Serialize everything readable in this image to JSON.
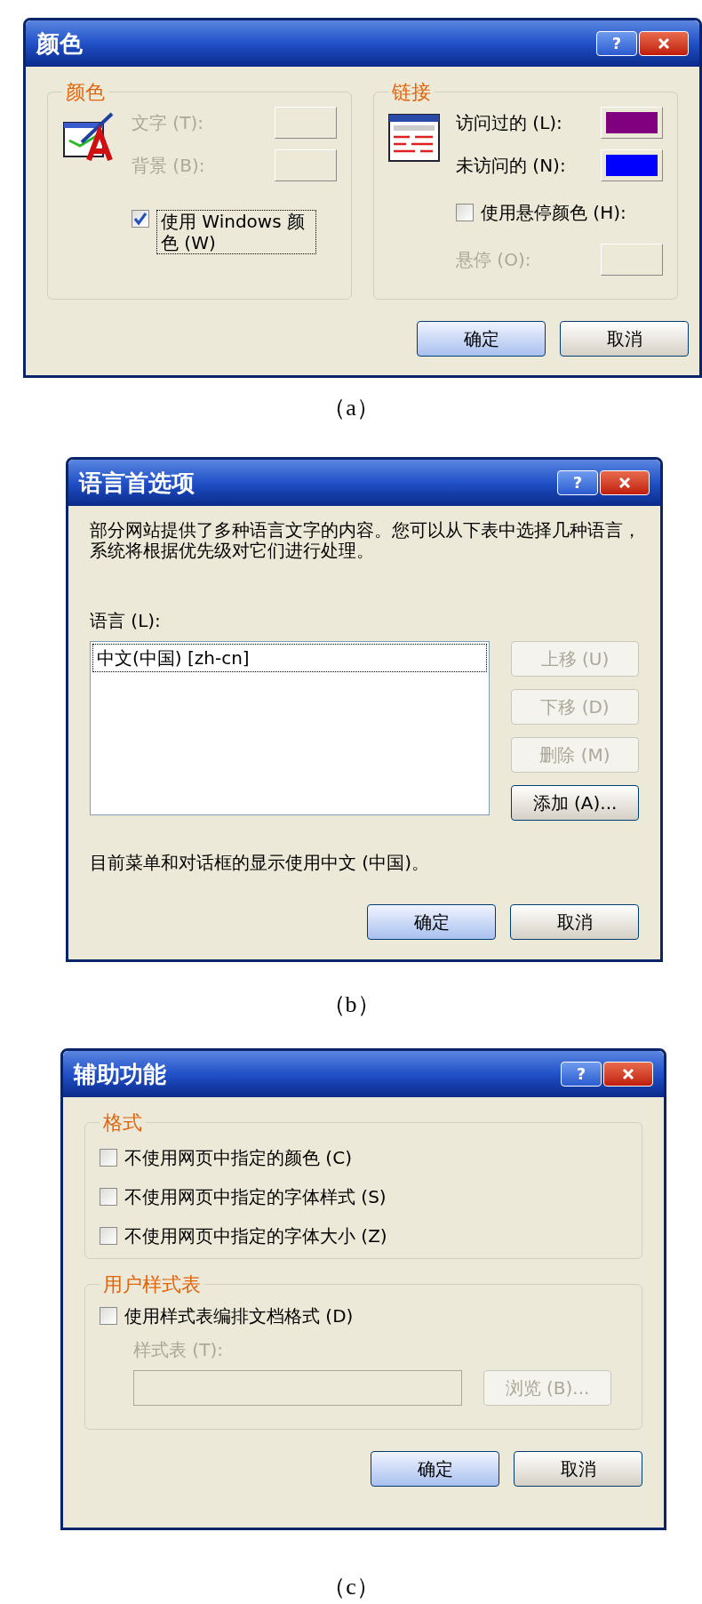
{
  "dialog_a": {
    "title": "颜色",
    "help_button": "?",
    "colors_group": {
      "legend": "颜色",
      "fields": [
        {
          "label": "文字 (T):",
          "disabled": true
        },
        {
          "label": "背景 (B):",
          "disabled": true
        }
      ],
      "use_windows_colors": {
        "label": "使用 Windows 颜色 (W)",
        "checked": true
      }
    },
    "links_group": {
      "legend": "链接",
      "swatches": [
        {
          "label": "访问过的 (L):",
          "color": "#800080"
        },
        {
          "label": "未访问的 (N):",
          "color": "#0000ff"
        }
      ],
      "use_hover": {
        "label": "使用悬停颜色 (H):",
        "checked": false
      },
      "hover": {
        "label": "悬停 (O):",
        "disabled": true
      }
    },
    "buttons": [
      {
        "label": "确定",
        "default": true
      },
      {
        "label": "取消",
        "default": false
      }
    ],
    "caption": "（a）"
  },
  "dialog_b": {
    "title": "语言首选项",
    "help_button": "?",
    "description": "部分网站提供了多种语言文字的内容。您可以从下表中选择几种语言，系统将根据优先级对它们进行处理。",
    "list_label": "语言 (L):",
    "languages": [
      {
        "text": "中文(中国) [zh-cn]",
        "selected": true
      }
    ],
    "side_buttons": [
      {
        "label": "上移 (U)",
        "disabled": true
      },
      {
        "label": "下移 (D)",
        "disabled": true
      },
      {
        "label": "删除 (M)",
        "disabled": true
      },
      {
        "label": "添加 (A)...",
        "disabled": false
      }
    ],
    "note": "目前菜单和对话框的显示使用中文 (中国)。",
    "buttons": [
      {
        "label": "确定",
        "default": true
      },
      {
        "label": "取消",
        "default": false
      }
    ],
    "caption": "（b）"
  },
  "dialog_c": {
    "title": "辅助功能",
    "help_button": "?",
    "format_group": {
      "legend": "格式",
      "options": [
        {
          "label": "不使用网页中指定的颜色 (C)",
          "checked": false
        },
        {
          "label": "不使用网页中指定的字体样式 (S)",
          "checked": false
        },
        {
          "label": "不使用网页中指定的字体大小 (Z)",
          "checked": false
        }
      ]
    },
    "style_group": {
      "legend": "用户样式表",
      "use_stylesheet": {
        "label": "使用样式表编排文档格式 (D)",
        "checked": false
      },
      "stylesheet_label": "样式表 (T):",
      "disabled": true,
      "browse_button": {
        "label": "浏览 (B)...",
        "disabled": true
      }
    },
    "buttons": [
      {
        "label": "确定",
        "default": true
      },
      {
        "label": "取消",
        "default": false
      }
    ],
    "caption": "（c）"
  }
}
